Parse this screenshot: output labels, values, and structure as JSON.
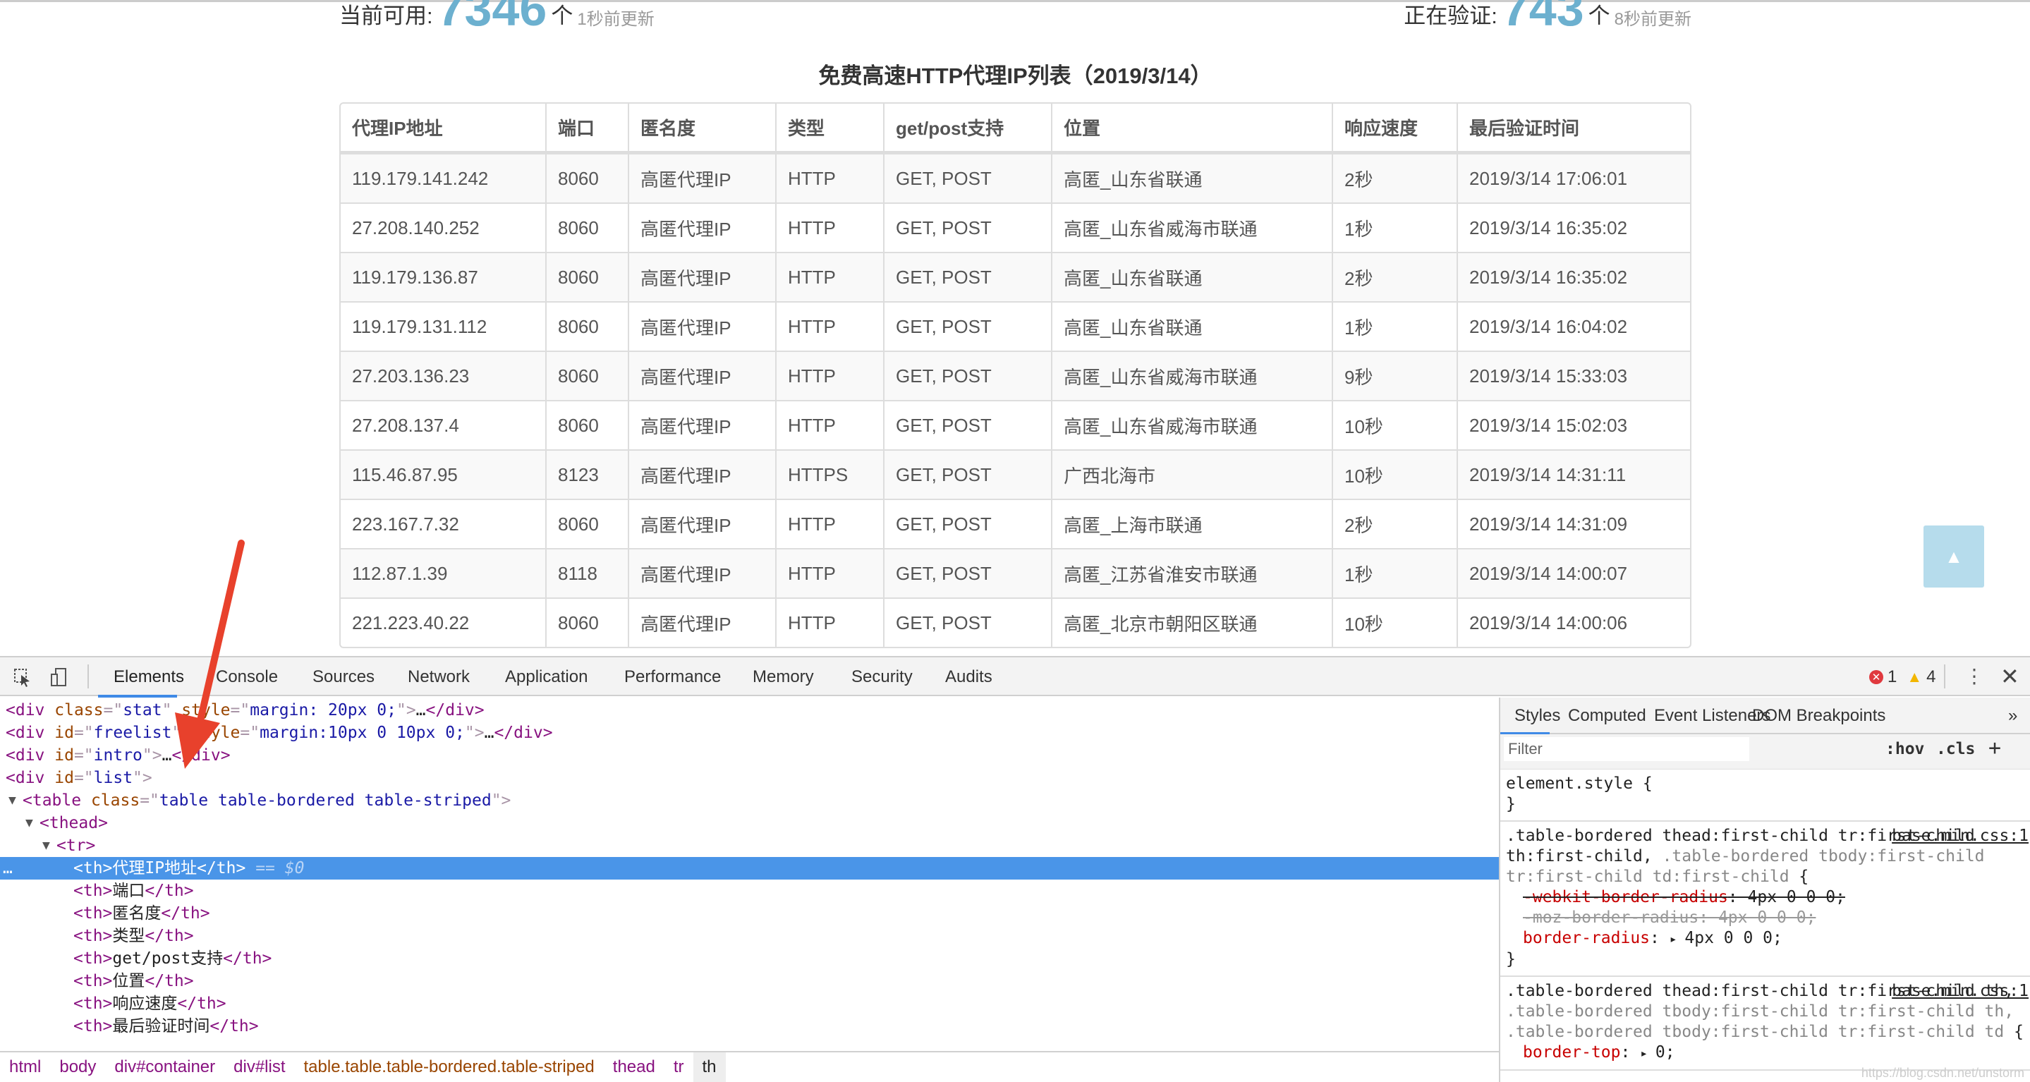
{
  "stats": {
    "available_label": "当前可用:",
    "available_count": "7346",
    "available_unit": "个",
    "available_updated": "1秒前更新",
    "verifying_label": "正在验证:",
    "verifying_count": "743",
    "verifying_unit": "个",
    "verifying_updated": "8秒前更新"
  },
  "title": "免费高速HTTP代理IP列表（2019/3/14）",
  "table": {
    "headers": [
      "代理IP地址",
      "端口",
      "匿名度",
      "类型",
      "get/post支持",
      "位置",
      "响应速度",
      "最后验证时间"
    ],
    "rows": [
      [
        "119.179.141.242",
        "8060",
        "高匿代理IP",
        "HTTP",
        "GET, POST",
        "高匿_山东省联通",
        "2秒",
        "2019/3/14 17:06:01"
      ],
      [
        "27.208.140.252",
        "8060",
        "高匿代理IP",
        "HTTP",
        "GET, POST",
        "高匿_山东省威海市联通",
        "1秒",
        "2019/3/14 16:35:02"
      ],
      [
        "119.179.136.87",
        "8060",
        "高匿代理IP",
        "HTTP",
        "GET, POST",
        "高匿_山东省联通",
        "2秒",
        "2019/3/14 16:35:02"
      ],
      [
        "119.179.131.112",
        "8060",
        "高匿代理IP",
        "HTTP",
        "GET, POST",
        "高匿_山东省联通",
        "1秒",
        "2019/3/14 16:04:02"
      ],
      [
        "27.203.136.23",
        "8060",
        "高匿代理IP",
        "HTTP",
        "GET, POST",
        "高匿_山东省威海市联通",
        "9秒",
        "2019/3/14 15:33:03"
      ],
      [
        "27.208.137.4",
        "8060",
        "高匿代理IP",
        "HTTP",
        "GET, POST",
        "高匿_山东省威海市联通",
        "10秒",
        "2019/3/14 15:02:03"
      ],
      [
        "115.46.87.95",
        "8123",
        "高匿代理IP",
        "HTTPS",
        "GET, POST",
        "广西北海市",
        "10秒",
        "2019/3/14 14:31:11"
      ],
      [
        "223.167.7.32",
        "8060",
        "高匿代理IP",
        "HTTP",
        "GET, POST",
        "高匿_上海市联通",
        "2秒",
        "2019/3/14 14:31:09"
      ],
      [
        "112.87.1.39",
        "8118",
        "高匿代理IP",
        "HTTP",
        "GET, POST",
        "高匿_江苏省淮安市联通",
        "1秒",
        "2019/3/14 14:00:07"
      ],
      [
        "221.223.40.22",
        "8060",
        "高匿代理IP",
        "HTTP",
        "GET, POST",
        "高匿_北京市朝阳区联通",
        "10秒",
        "2019/3/14 14:00:06"
      ]
    ]
  },
  "scroll_top_icon": "chevron-up-icon",
  "devtools": {
    "tabs": [
      "Elements",
      "Console",
      "Sources",
      "Network",
      "Application",
      "Performance",
      "Memory",
      "Security",
      "Audits"
    ],
    "active_tab": "Elements",
    "errors": "1",
    "warnings": "4",
    "colors": {
      "accent": "#3f8ae6",
      "selected": "#4a95e8",
      "error": "#e0393e",
      "warning": "#f2b600"
    },
    "dom_lines": [
      {
        "indent": 2,
        "arrow": "▶",
        "tokens": [
          [
            "tag",
            "<div "
          ],
          [
            "attr",
            "class"
          ],
          [
            "punct",
            "=\""
          ],
          [
            "val",
            "stat"
          ],
          [
            "punct",
            "\" "
          ],
          [
            "attr",
            "style"
          ],
          [
            "punct",
            "=\""
          ],
          [
            "val",
            "margin: 20px 0;"
          ],
          [
            "punct",
            "\">"
          ],
          [
            "text",
            "…"
          ],
          [
            "tag",
            "</div>"
          ]
        ]
      },
      {
        "indent": 2,
        "arrow": "▶",
        "tokens": [
          [
            "tag",
            "<div "
          ],
          [
            "attr",
            "id"
          ],
          [
            "punct",
            "=\""
          ],
          [
            "val",
            "freelist"
          ],
          [
            "punct",
            "\" "
          ],
          [
            "attr",
            "style"
          ],
          [
            "punct",
            "=\""
          ],
          [
            "val",
            "margin:10px 0 10px 0;"
          ],
          [
            "punct",
            "\">"
          ],
          [
            "text",
            "…"
          ],
          [
            "tag",
            "</div>"
          ]
        ]
      },
      {
        "indent": 2,
        "arrow": "▶",
        "tokens": [
          [
            "tag",
            "<div "
          ],
          [
            "attr",
            "id"
          ],
          [
            "punct",
            "=\""
          ],
          [
            "val",
            "intro"
          ],
          [
            "punct",
            "\">"
          ],
          [
            "text",
            "…"
          ],
          [
            "tag",
            "</div>"
          ]
        ]
      },
      {
        "indent": 2,
        "arrow": "▼",
        "tokens": [
          [
            "tag",
            "<div "
          ],
          [
            "attr",
            "id"
          ],
          [
            "punct",
            "=\""
          ],
          [
            "val",
            "list"
          ],
          [
            "punct",
            "\">"
          ]
        ]
      },
      {
        "indent": 3,
        "arrow": "▼",
        "tokens": [
          [
            "tag",
            "<table "
          ],
          [
            "attr",
            "class"
          ],
          [
            "punct",
            "=\""
          ],
          [
            "val",
            "table table-bordered table-striped"
          ],
          [
            "punct",
            "\">"
          ]
        ]
      },
      {
        "indent": 4,
        "arrow": "▼",
        "tokens": [
          [
            "tag",
            "<thead>"
          ]
        ]
      },
      {
        "indent": 5,
        "arrow": "▼",
        "tokens": [
          [
            "tag",
            "<tr>"
          ]
        ]
      },
      {
        "indent": 6,
        "arrow": "",
        "selected": true,
        "tokens": [
          [
            "tag",
            "<th>"
          ],
          [
            "text",
            "代理IP地址"
          ],
          [
            "tag",
            "</th>"
          ],
          [
            "dim",
            " == $0"
          ]
        ]
      },
      {
        "indent": 6,
        "arrow": "",
        "tokens": [
          [
            "tag",
            "<th>"
          ],
          [
            "text",
            "端口"
          ],
          [
            "tag",
            "</th>"
          ]
        ]
      },
      {
        "indent": 6,
        "arrow": "",
        "tokens": [
          [
            "tag",
            "<th>"
          ],
          [
            "text",
            "匿名度"
          ],
          [
            "tag",
            "</th>"
          ]
        ]
      },
      {
        "indent": 6,
        "arrow": "",
        "tokens": [
          [
            "tag",
            "<th>"
          ],
          [
            "text",
            "类型"
          ],
          [
            "tag",
            "</th>"
          ]
        ]
      },
      {
        "indent": 6,
        "arrow": "",
        "tokens": [
          [
            "tag",
            "<th>"
          ],
          [
            "text",
            "get/post支持"
          ],
          [
            "tag",
            "</th>"
          ]
        ]
      },
      {
        "indent": 6,
        "arrow": "",
        "tokens": [
          [
            "tag",
            "<th>"
          ],
          [
            "text",
            "位置"
          ],
          [
            "tag",
            "</th>"
          ]
        ]
      },
      {
        "indent": 6,
        "arrow": "",
        "tokens": [
          [
            "tag",
            "<th>"
          ],
          [
            "text",
            "响应速度"
          ],
          [
            "tag",
            "</th>"
          ]
        ]
      },
      {
        "indent": 6,
        "arrow": "",
        "tokens": [
          [
            "tag",
            "<th>"
          ],
          [
            "text",
            "最后验证时间"
          ],
          [
            "tag",
            "</th>"
          ]
        ]
      }
    ],
    "breadcrumbs": [
      "html",
      "body",
      "div#container",
      "div#list",
      "table.table.table-bordered.table-striped",
      "thead",
      "tr",
      "th"
    ],
    "side_tabs": [
      "Styles",
      "Computed",
      "Event Listeners",
      "DOM Breakpoints"
    ],
    "filter_placeholder": "Filter",
    "hov": ":hov",
    "cls": ".cls",
    "rules": [
      {
        "selector": "element.style {",
        "dim_selector": "",
        "source": "",
        "props": [],
        "close": "}"
      },
      {
        "selector": ".table-bordered thead:first-child tr:first-child th:first-child, ",
        "dim_selector": ".table-bordered tbody:first-child tr:first-child td:first-child",
        "open": " {",
        "source": "base.min.css:1",
        "props": [
          {
            "name": "-webkit-border-radius",
            "value": "4px 0 0 0;",
            "state": "overridden"
          },
          {
            "name": "-moz-border-radius",
            "value": "4px 0 0 0;",
            "state": "invalid"
          },
          {
            "name": "border-radius",
            "value": "4px 0 0 0;",
            "state": "active"
          }
        ],
        "close": "}"
      },
      {
        "selector": ".table-bordered thead:first-child tr:first-child th, ",
        "dim_selector": ".table-bordered tbody:first-child tr:first-child th, .table-bordered tbody:first-child tr:first-child td",
        "open": " {",
        "source": "base.min.css:1",
        "props": [
          {
            "name": "border-top",
            "value": "0;",
            "state": "active"
          }
        ],
        "close": ""
      }
    ],
    "watermark": "https://blog.csdn.net/unstorm"
  }
}
